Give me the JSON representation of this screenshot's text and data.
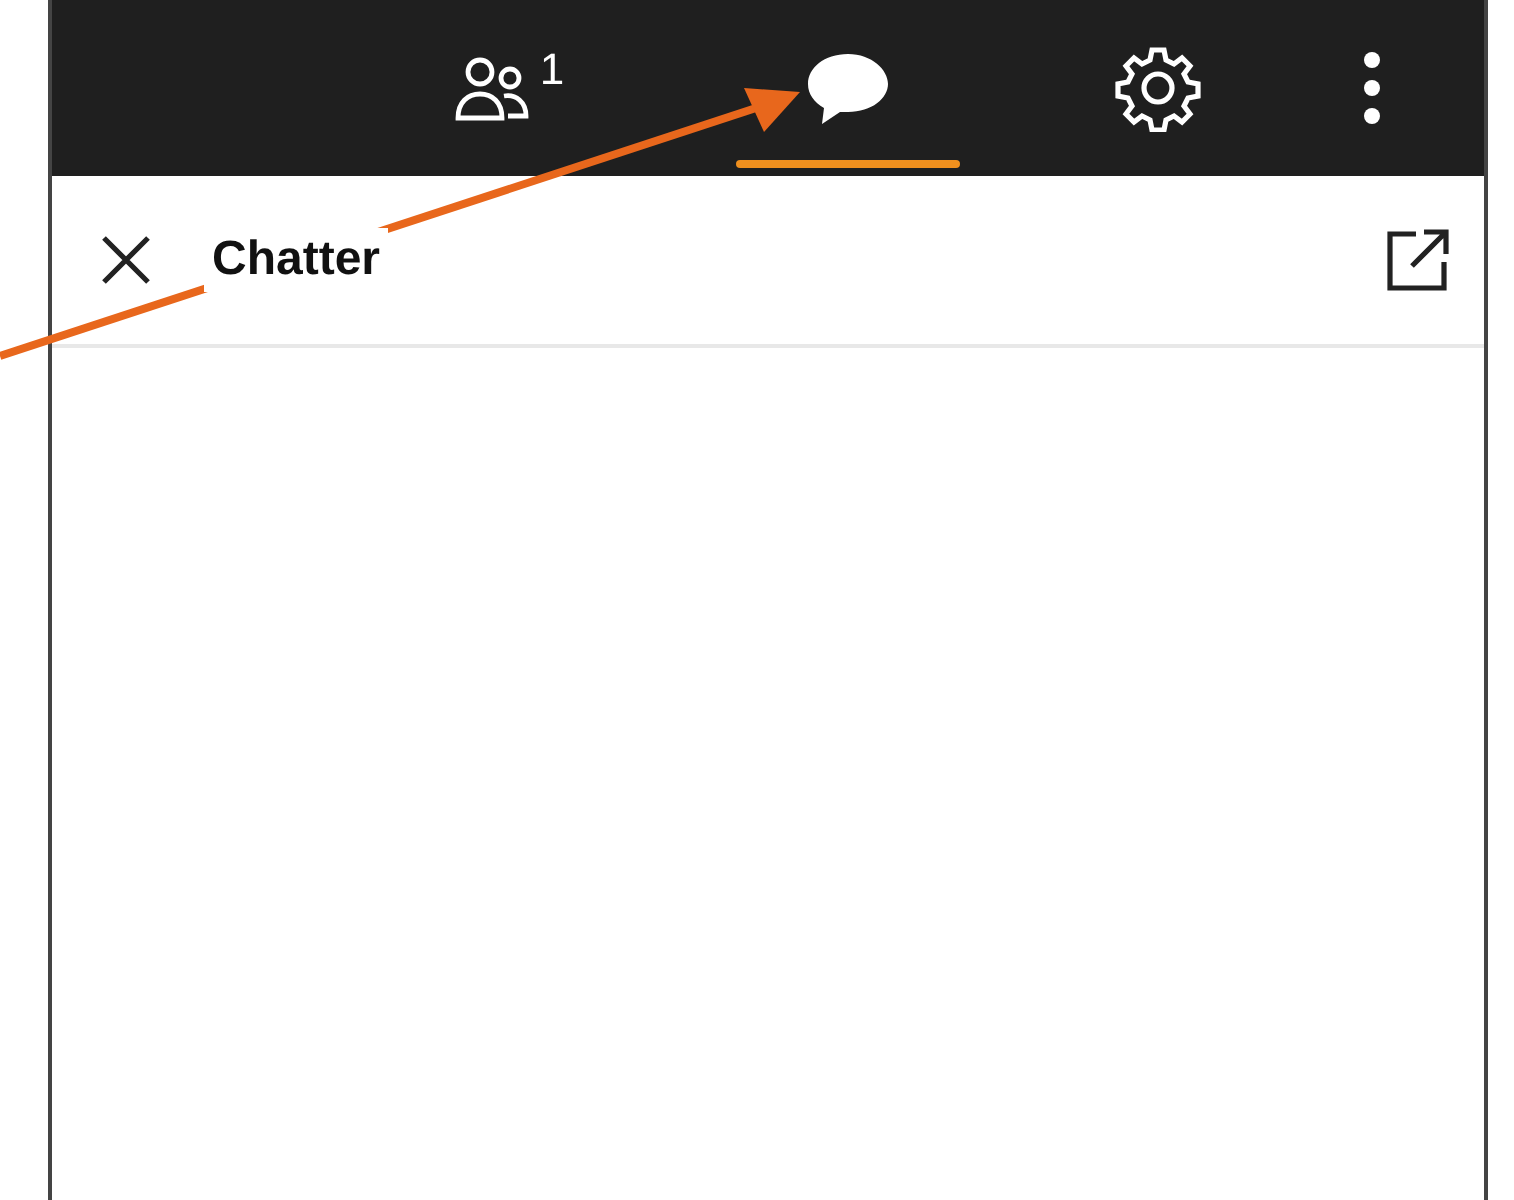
{
  "tabs": [
    {
      "kind": "people",
      "badge": "1",
      "selected": false
    },
    {
      "kind": "chat",
      "selected": true
    },
    {
      "kind": "settings",
      "selected": false
    },
    {
      "kind": "more",
      "selected": false
    }
  ],
  "header": {
    "title": "Chatter"
  }
}
